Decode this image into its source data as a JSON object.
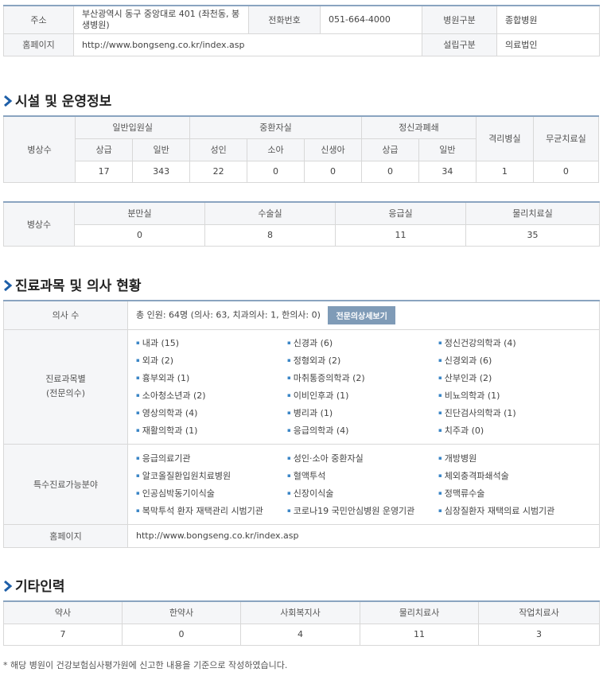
{
  "basic": {
    "address_label": "주소",
    "address_value": "부산광역시 동구 중앙대로 401 (좌천동, 봉생병원)",
    "phone_label": "전화번호",
    "phone_value": "051-664-4000",
    "type_label": "병원구분",
    "type_value": "종합병원",
    "homepage_label": "홈페이지",
    "homepage_value": "http://www.bongseng.co.kr/index.asp",
    "founding_label": "설립구분",
    "founding_value": "의료법인"
  },
  "facility": {
    "title": "시설 및 운영정보",
    "beds_label": "병상수",
    "general_ward": "일반입원실",
    "icu": "중환자실",
    "psych": "정신과폐쇄",
    "isolation": "격리병실",
    "sterile": "무균치료실",
    "sub_premium": "상급",
    "sub_general": "일반",
    "sub_adult": "성인",
    "sub_child": "소아",
    "sub_newborn": "신생아",
    "sub_premium2": "상급",
    "sub_general2": "일반",
    "values": [
      "17",
      "343",
      "22",
      "0",
      "0",
      "0",
      "34",
      "1",
      "0"
    ],
    "beds_label2": "병상수",
    "delivery": "분만실",
    "surgery": "수술실",
    "emergency": "응급실",
    "physio": "물리치료실",
    "values2": [
      "0",
      "8",
      "11",
      "35"
    ]
  },
  "doctors": {
    "title": "진료과목 및 의사 현황",
    "count_label": "의사 수",
    "count_value": "총 인원: 64명 (의사: 63, 치과의사: 1, 한의사: 0)",
    "detail_button": "전문의상세보기",
    "dept_label_1": "진료과목별",
    "dept_label_2": "(전문의수)",
    "departments": [
      "내과 (15)",
      "신경과 (6)",
      "정신건강의학과 (4)",
      "외과 (2)",
      "정형외과 (2)",
      "신경외과 (6)",
      "흉부외과 (1)",
      "마취통증의학과 (2)",
      "산부인과 (2)",
      "소아청소년과 (2)",
      "이비인후과 (1)",
      "비뇨의학과 (1)",
      "영상의학과 (4)",
      "병리과 (1)",
      "진단검사의학과 (1)",
      "재활의학과 (1)",
      "응급의학과 (4)",
      "치주과 (0)"
    ],
    "special_label": "특수진료가능분야",
    "special": [
      "응급의료기관",
      "성인·소아 중환자실",
      "개방병원",
      "알코올질환입원치료병원",
      "혈액투석",
      "체외충격파쇄석술",
      "인공심박동기이식술",
      "신장이식술",
      "정맥류수술",
      "복막투석 환자 재택관리 시범기관",
      "코로나19 국민안심병원 운영기관",
      "심장질환자 재택의료 시범기관"
    ],
    "homepage_label": "홈페이지",
    "homepage_value": "http://www.bongseng.co.kr/index.asp"
  },
  "staff": {
    "title": "기타인력",
    "headers": [
      "약사",
      "한약사",
      "사회복지사",
      "물리치료사",
      "작업치료사"
    ],
    "values": [
      "7",
      "0",
      "4",
      "11",
      "3"
    ]
  },
  "footnote": "* 해당 병원이 건강보험심사평가원에 신고한 내용을 기준으로 작성하였습니다.",
  "colors": {
    "accent": "#3b86c6",
    "border_top": "#8aa4c0",
    "button": "#7f9bb7"
  }
}
